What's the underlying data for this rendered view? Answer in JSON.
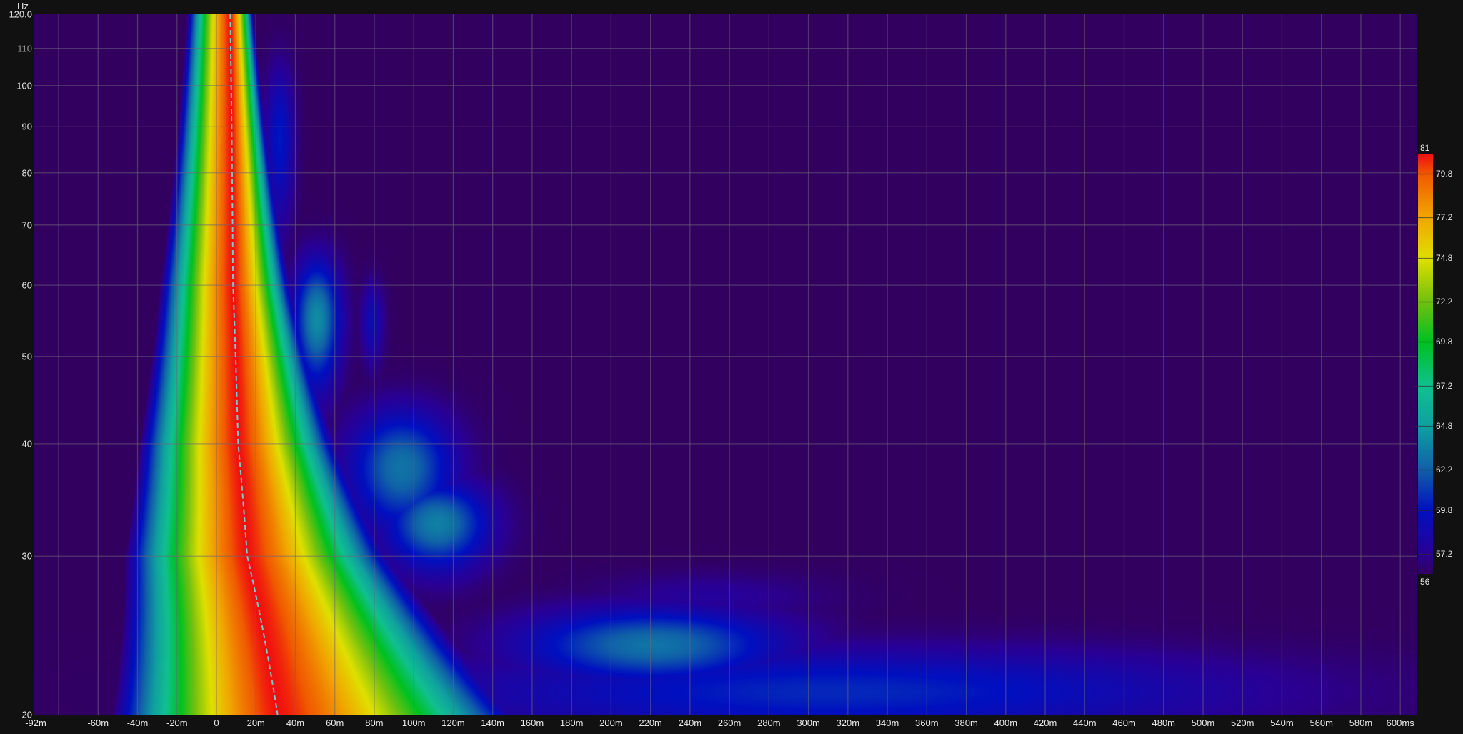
{
  "chart_data": {
    "type": "heatmap",
    "title": "",
    "xlabel": "",
    "ylabel": "Hz",
    "x_unit": "ms",
    "xlim": [
      -92,
      606
    ],
    "ylim": [
      20,
      120
    ],
    "y_scale": "log",
    "grid": true,
    "x_ticks": [
      {
        "v": -92,
        "label": "-92m"
      },
      {
        "v": -60,
        "label": "-60m"
      },
      {
        "v": -40,
        "label": "-40m"
      },
      {
        "v": -20,
        "label": "-20m"
      },
      {
        "v": 0,
        "label": "0"
      },
      {
        "v": 20,
        "label": "20m"
      },
      {
        "v": 40,
        "label": "40m"
      },
      {
        "v": 60,
        "label": "60m"
      },
      {
        "v": 80,
        "label": "80m"
      },
      {
        "v": 100,
        "label": "100m"
      },
      {
        "v": 120,
        "label": "120m"
      },
      {
        "v": 140,
        "label": "140m"
      },
      {
        "v": 160,
        "label": "160m"
      },
      {
        "v": 180,
        "label": "180m"
      },
      {
        "v": 200,
        "label": "200m"
      },
      {
        "v": 220,
        "label": "220m"
      },
      {
        "v": 240,
        "label": "240m"
      },
      {
        "v": 260,
        "label": "260m"
      },
      {
        "v": 280,
        "label": "280m"
      },
      {
        "v": 300,
        "label": "300m"
      },
      {
        "v": 320,
        "label": "320m"
      },
      {
        "v": 340,
        "label": "340m"
      },
      {
        "v": 360,
        "label": "360m"
      },
      {
        "v": 380,
        "label": "380m"
      },
      {
        "v": 400,
        "label": "400m"
      },
      {
        "v": 420,
        "label": "420m"
      },
      {
        "v": 440,
        "label": "440m"
      },
      {
        "v": 460,
        "label": "460m"
      },
      {
        "v": 480,
        "label": "480m"
      },
      {
        "v": 500,
        "label": "500m"
      },
      {
        "v": 520,
        "label": "520m"
      },
      {
        "v": 540,
        "label": "540m"
      },
      {
        "v": 560,
        "label": "560m"
      },
      {
        "v": 580,
        "label": "580m"
      },
      {
        "v": 600,
        "label": "600ms"
      }
    ],
    "x_gridlines": [
      -80,
      -60,
      -40,
      -20,
      0,
      20,
      40,
      60,
      80,
      100,
      120,
      140,
      160,
      180,
      200,
      220,
      240,
      260,
      280,
      300,
      320,
      340,
      360,
      380,
      400,
      420,
      440,
      460,
      480,
      500,
      520,
      540,
      560,
      580,
      600
    ],
    "y_ticks": [
      {
        "v": 120,
        "label": "120.0",
        "minor": false
      },
      {
        "v": 110,
        "label": "110",
        "minor": true
      },
      {
        "v": 100,
        "label": "100",
        "minor": false
      },
      {
        "v": 90,
        "label": "90",
        "minor": false
      },
      {
        "v": 80,
        "label": "80",
        "minor": false
      },
      {
        "v": 70,
        "label": "70",
        "minor": false
      },
      {
        "v": 60,
        "label": "60",
        "minor": false
      },
      {
        "v": 50,
        "label": "50",
        "minor": false
      },
      {
        "v": 40,
        "label": "40",
        "minor": false
      },
      {
        "v": 30,
        "label": "30",
        "minor": false
      },
      {
        "v": 20,
        "label": "20",
        "minor": false
      }
    ],
    "y_gridlines": [
      30,
      40,
      50,
      60,
      70,
      80,
      90,
      100,
      110
    ],
    "colorbar": {
      "range": [
        56,
        81
      ],
      "ticks": [
        {
          "v": 81,
          "label": "81"
        },
        {
          "v": 79.8,
          "label": "79.8"
        },
        {
          "v": 77.2,
          "label": "77.2"
        },
        {
          "v": 74.8,
          "label": "74.8"
        },
        {
          "v": 72.2,
          "label": "72.2"
        },
        {
          "v": 69.8,
          "label": "69.8"
        },
        {
          "v": 67.2,
          "label": "67.2"
        },
        {
          "v": 64.8,
          "label": "64.8"
        },
        {
          "v": 62.2,
          "label": "62.2"
        },
        {
          "v": 59.8,
          "label": "59.8"
        },
        {
          "v": 57.2,
          "label": "57.2"
        },
        {
          "v": 56,
          "label": "56"
        }
      ],
      "stops": [
        {
          "v": 56,
          "color": "#32005f"
        },
        {
          "v": 57.2,
          "color": "#2a0095"
        },
        {
          "v": 59.8,
          "color": "#0010c0"
        },
        {
          "v": 62.2,
          "color": "#1060a8"
        },
        {
          "v": 64.8,
          "color": "#10a0a0"
        },
        {
          "v": 67.2,
          "color": "#10c090"
        },
        {
          "v": 69.8,
          "color": "#00c020"
        },
        {
          "v": 72.2,
          "color": "#70c010"
        },
        {
          "v": 74.8,
          "color": "#e0e000"
        },
        {
          "v": 77.2,
          "color": "#f0a800"
        },
        {
          "v": 79.8,
          "color": "#f05a00"
        },
        {
          "v": 81,
          "color": "#f01010"
        }
      ]
    },
    "peak_ridge": {
      "peak_level_db": 81,
      "center_ms_by_freq": [
        [
          120,
          7
        ],
        [
          60,
          8.4
        ],
        [
          40,
          11
        ],
        [
          30,
          15.6
        ],
        [
          20,
          31
        ]
      ],
      "left_halfwidth_ms_at_120hz": 22,
      "right_halfwidth_ms_at_120hz": 12
    },
    "secondary_regions": [
      {
        "t_ms": 51,
        "f_hz": 55,
        "level_db": 64,
        "sigma_t_ms": 8,
        "sigma_f_hz": 6
      },
      {
        "t_ms": 32,
        "f_hz": 87,
        "level_db": 60,
        "sigma_t_ms": 5,
        "sigma_f_hz": 12
      },
      {
        "t_ms": 94,
        "f_hz": 37.6,
        "level_db": 63,
        "sigma_t_ms": 18,
        "sigma_f_hz": 4
      },
      {
        "t_ms": 112,
        "f_hz": 32.6,
        "level_db": 63.5,
        "sigma_t_ms": 18,
        "sigma_f_hz": 2.5
      },
      {
        "t_ms": 79,
        "f_hz": 54.6,
        "level_db": 59,
        "sigma_t_ms": 4,
        "sigma_f_hz": 4
      },
      {
        "t_ms": 221,
        "f_hz": 23.9,
        "level_db": 63,
        "sigma_t_ms": 45,
        "sigma_f_hz": 1.6
      },
      {
        "t_ms": 315,
        "f_hz": 21.2,
        "level_db": 60.5,
        "sigma_t_ms": 140,
        "sigma_f_hz": 1.7
      },
      {
        "t_ms": 250,
        "f_hz": 27,
        "level_db": 57.5,
        "sigma_t_ms": 40,
        "sigma_f_hz": 1.2
      }
    ],
    "ridge_line_color": "#6fd0cc"
  }
}
